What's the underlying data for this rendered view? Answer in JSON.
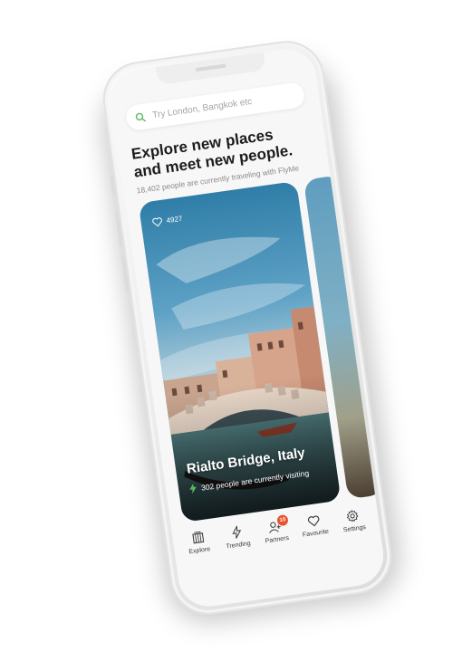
{
  "search": {
    "placeholder": "Try London, Bangkok etc"
  },
  "header": {
    "title_line1": "Explore new places",
    "title_line2": "and meet new people.",
    "subtitle": "18,402 people are currently traveling with FlyMe"
  },
  "card": {
    "likes": "4927",
    "title": "Rialto Bridge, Italy",
    "visitors": "302 people are currently visiting"
  },
  "tabs": [
    {
      "label": "Explore",
      "icon": "explore-icon"
    },
    {
      "label": "Trending",
      "icon": "lightning-icon"
    },
    {
      "label": "Partners",
      "icon": "user-add-icon",
      "badge": "10"
    },
    {
      "label": "Favourite",
      "icon": "heart-icon"
    },
    {
      "label": "Settings",
      "icon": "gear-icon"
    }
  ],
  "colors": {
    "accent": "#5cb85c",
    "badge": "#e8542f",
    "title": "#1c1c1c"
  }
}
